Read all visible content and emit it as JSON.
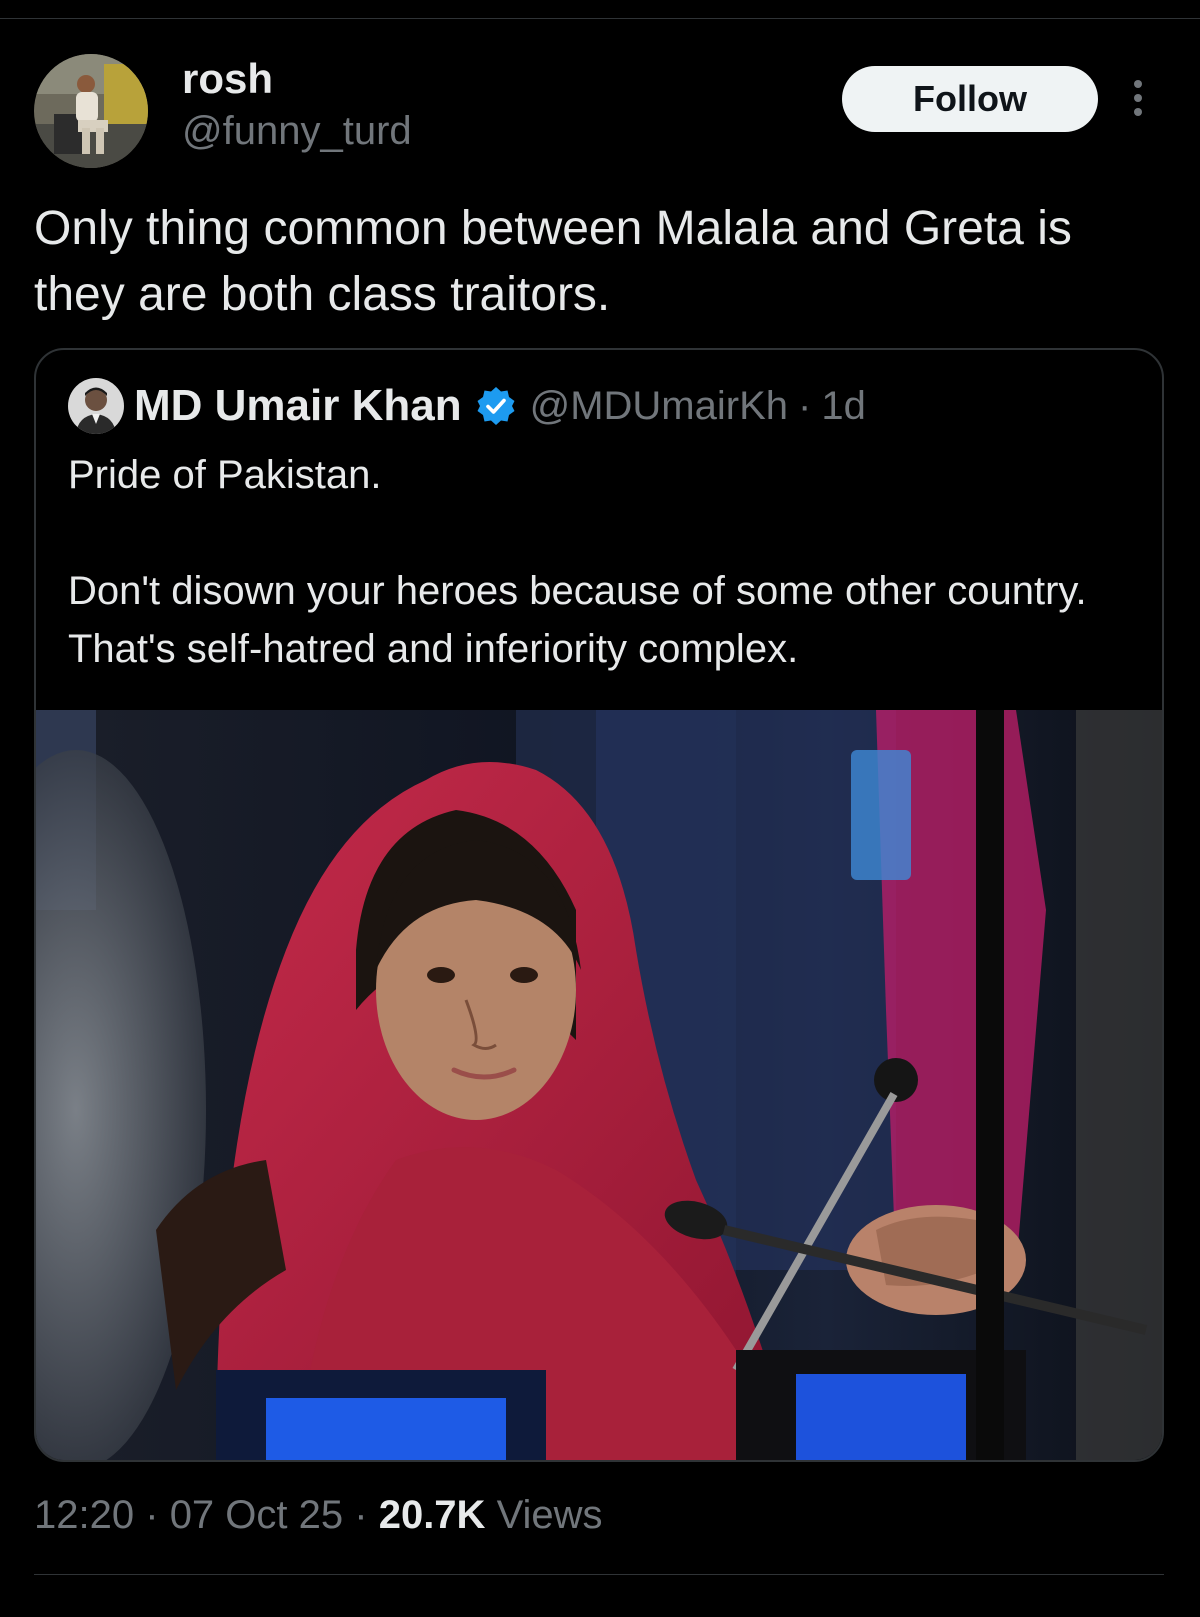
{
  "post": {
    "author": {
      "name": "rosh",
      "handle": "@funny_turd"
    },
    "follow_label": "Follow",
    "text": "Only thing common between Malala and Greta is they are both class traitors."
  },
  "quoted_post": {
    "author_name": "MD Umair Khan",
    "handle": "@MDUmairKh",
    "separator": "·",
    "time": "1d",
    "paragraphs": [
      "Pride of Pakistan.",
      "Don't disown your heroes because of some other country. That's self-hatred and inferiority complex."
    ]
  },
  "meta": {
    "time": "12:20",
    "separator": "·",
    "date": "07 Oct 25",
    "views_count": "20.7K",
    "views_label": "Views"
  },
  "colors": {
    "background": "#000000",
    "text_primary": "#e7e9ea",
    "text_secondary": "#71767b",
    "border": "#2f3336",
    "follow_button_bg": "#eff3f4",
    "verified_badge": "#1d9bf0",
    "photo_scarf": "#b01e3c"
  },
  "icons": {
    "more": "more-vertical-icon",
    "verified": "verified-badge-icon"
  }
}
